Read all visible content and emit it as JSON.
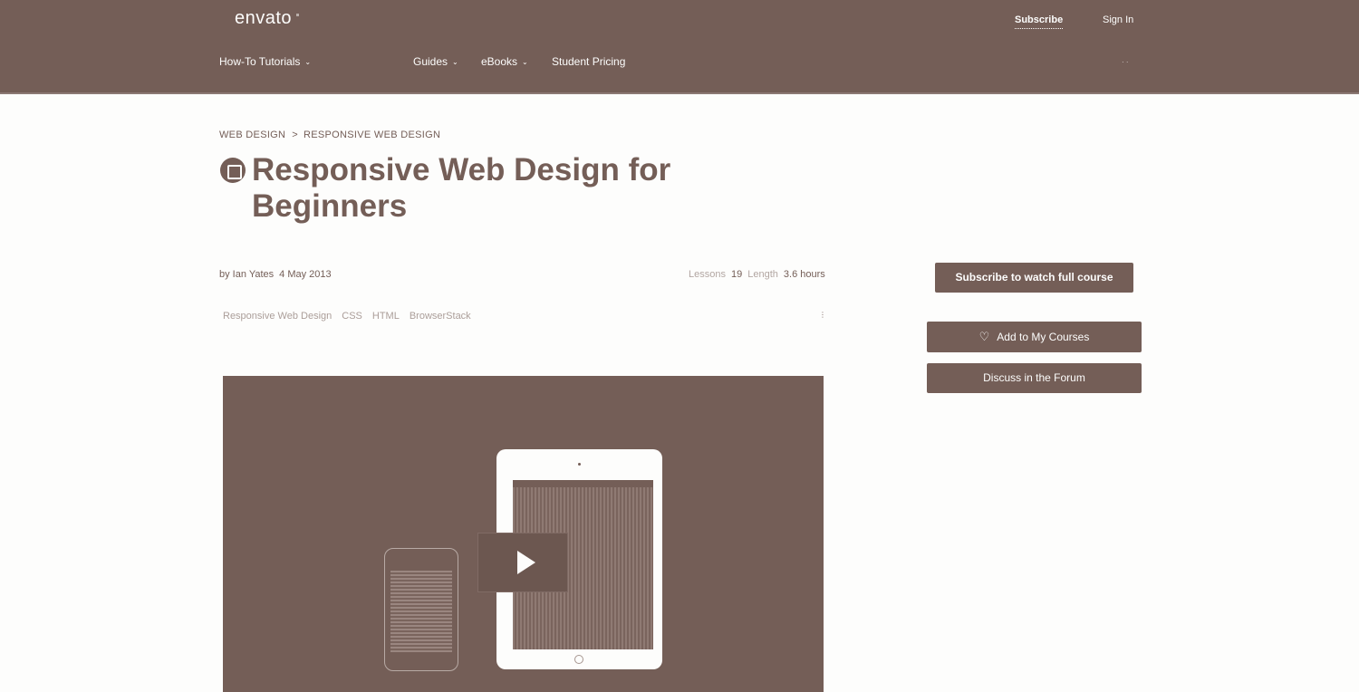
{
  "header": {
    "logo": "envato",
    "subscribe": "Subscribe",
    "sign_in": "Sign In",
    "nav": [
      {
        "label": "How-To Tutorials"
      },
      {
        "label": "Guides"
      },
      {
        "label": "eBooks"
      },
      {
        "label": "Student Pricing"
      }
    ],
    "chevron": "⌄",
    "nav_more": "·  ·"
  },
  "breadcrumb": {
    "items": [
      "WEB DESIGN",
      "RESPONSIVE WEB DESIGN"
    ],
    "separator": ">"
  },
  "course": {
    "title": "Responsive Web Design for Beginners",
    "author": "by Ian Yates",
    "date": "4 May 2013",
    "lessons_label": "Lessons",
    "lessons": "19",
    "length_label": "Length",
    "length": "3.6 hours",
    "tags": [
      "Responsive Web Design",
      "CSS",
      "HTML",
      "BrowserStack"
    ]
  },
  "sidebar": {
    "subscribe_button": "Subscribe to watch full course",
    "add_button": "Add to My Courses",
    "discuss_button": "Discuss in the Forum"
  },
  "icons": {
    "course": "grid-icon",
    "heart": "heart-icon",
    "play": "play-icon"
  },
  "colors": {
    "brand": "#745e57",
    "background": "#fdfdfc"
  }
}
